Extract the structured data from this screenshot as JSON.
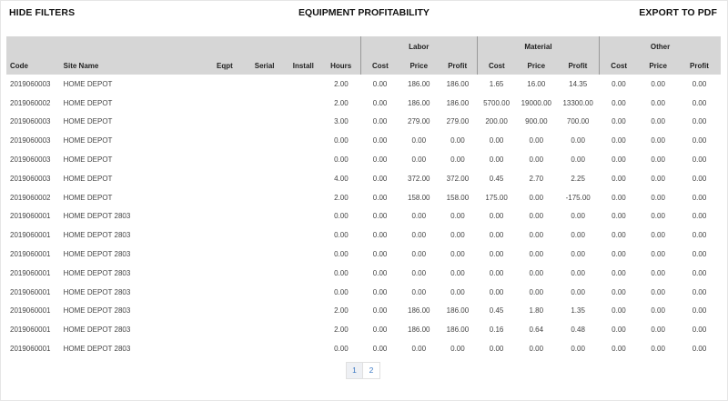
{
  "header": {
    "hide_filters": "HIDE FILTERS",
    "title": "EQUIPMENT PROFITABILITY",
    "export": "EXPORT TO PDF"
  },
  "groups": [
    "Labor",
    "Material",
    "Other"
  ],
  "columns": [
    "Code",
    "Site Name",
    "Eqpt",
    "Serial",
    "Install",
    "Hours",
    "Cost",
    "Price",
    "Profit",
    "Cost",
    "Price",
    "Profit",
    "Cost",
    "Price",
    "Profit"
  ],
  "rows": [
    [
      "2019060003",
      "HOME DEPOT",
      "",
      "",
      "",
      "2.00",
      "0.00",
      "186.00",
      "186.00",
      "1.65",
      "16.00",
      "14.35",
      "0.00",
      "0.00",
      "0.00"
    ],
    [
      "2019060002",
      "HOME DEPOT",
      "",
      "",
      "",
      "2.00",
      "0.00",
      "186.00",
      "186.00",
      "5700.00",
      "19000.00",
      "13300.00",
      "0.00",
      "0.00",
      "0.00"
    ],
    [
      "2019060003",
      "HOME DEPOT",
      "",
      "",
      "",
      "3.00",
      "0.00",
      "279.00",
      "279.00",
      "200.00",
      "900.00",
      "700.00",
      "0.00",
      "0.00",
      "0.00"
    ],
    [
      "2019060003",
      "HOME DEPOT",
      "",
      "",
      "",
      "0.00",
      "0.00",
      "0.00",
      "0.00",
      "0.00",
      "0.00",
      "0.00",
      "0.00",
      "0.00",
      "0.00"
    ],
    [
      "2019060003",
      "HOME DEPOT",
      "",
      "",
      "",
      "0.00",
      "0.00",
      "0.00",
      "0.00",
      "0.00",
      "0.00",
      "0.00",
      "0.00",
      "0.00",
      "0.00"
    ],
    [
      "2019060003",
      "HOME DEPOT",
      "",
      "",
      "",
      "4.00",
      "0.00",
      "372.00",
      "372.00",
      "0.45",
      "2.70",
      "2.25",
      "0.00",
      "0.00",
      "0.00"
    ],
    [
      "2019060002",
      "HOME DEPOT",
      "",
      "",
      "",
      "2.00",
      "0.00",
      "158.00",
      "158.00",
      "175.00",
      "0.00",
      "-175.00",
      "0.00",
      "0.00",
      "0.00"
    ],
    [
      "2019060001",
      "HOME DEPOT 2803",
      "",
      "",
      "",
      "0.00",
      "0.00",
      "0.00",
      "0.00",
      "0.00",
      "0.00",
      "0.00",
      "0.00",
      "0.00",
      "0.00"
    ],
    [
      "2019060001",
      "HOME DEPOT 2803",
      "",
      "",
      "",
      "0.00",
      "0.00",
      "0.00",
      "0.00",
      "0.00",
      "0.00",
      "0.00",
      "0.00",
      "0.00",
      "0.00"
    ],
    [
      "2019060001",
      "HOME DEPOT 2803",
      "",
      "",
      "",
      "0.00",
      "0.00",
      "0.00",
      "0.00",
      "0.00",
      "0.00",
      "0.00",
      "0.00",
      "0.00",
      "0.00"
    ],
    [
      "2019060001",
      "HOME DEPOT 2803",
      "",
      "",
      "",
      "0.00",
      "0.00",
      "0.00",
      "0.00",
      "0.00",
      "0.00",
      "0.00",
      "0.00",
      "0.00",
      "0.00"
    ],
    [
      "2019060001",
      "HOME DEPOT 2803",
      "",
      "",
      "",
      "0.00",
      "0.00",
      "0.00",
      "0.00",
      "0.00",
      "0.00",
      "0.00",
      "0.00",
      "0.00",
      "0.00"
    ],
    [
      "2019060001",
      "HOME DEPOT 2803",
      "",
      "",
      "",
      "2.00",
      "0.00",
      "186.00",
      "186.00",
      "0.45",
      "1.80",
      "1.35",
      "0.00",
      "0.00",
      "0.00"
    ],
    [
      "2019060001",
      "HOME DEPOT 2803",
      "",
      "",
      "",
      "2.00",
      "0.00",
      "186.00",
      "186.00",
      "0.16",
      "0.64",
      "0.48",
      "0.00",
      "0.00",
      "0.00"
    ],
    [
      "2019060001",
      "HOME DEPOT 2803",
      "",
      "",
      "",
      "0.00",
      "0.00",
      "0.00",
      "0.00",
      "0.00",
      "0.00",
      "0.00",
      "0.00",
      "0.00",
      "0.00"
    ]
  ],
  "pagination": {
    "pages": [
      "1",
      "2"
    ],
    "current": "1"
  }
}
